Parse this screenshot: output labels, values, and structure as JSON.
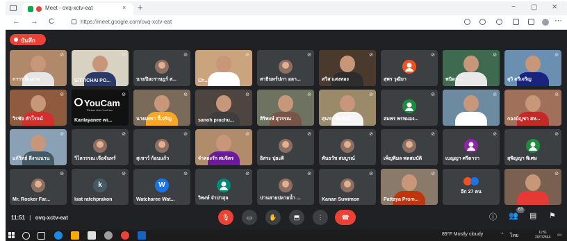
{
  "browser": {
    "tab_title": "Meet - ovq-xctv-eat",
    "tab_close": "×",
    "new_tab": "+",
    "url": "https://meet.google.com/ovq-xctv-eat",
    "win_min": "−",
    "win_max": "▢",
    "win_close": "✕",
    "back": "←",
    "forward": "→",
    "reload": "C",
    "more": "⋯"
  },
  "recording_label": "บันทึก",
  "tiles": [
    {
      "name": "กาาร ผิ้นลาจ",
      "type": "video",
      "bg": "#b0896b",
      "shirt": "#e6e6e6"
    },
    {
      "name": "SITTICHAI PO...",
      "type": "video",
      "bg": "#d8d2c2",
      "shirt": "#2b3a67"
    },
    {
      "name": "นายปิยะราษฎร์ ส...",
      "type": "photo",
      "bg": "#3c4043"
    },
    {
      "name": "Ch...",
      "type": "video",
      "bg": "#c9a47c",
      "shirt": "#ffffff"
    },
    {
      "name": "สาธินทร์ปภา อลา...",
      "type": "photo",
      "bg": "#3c4043"
    },
    {
      "name": "สวิส แสงทอง",
      "type": "video",
      "bg": "#4a3a2e",
      "shirt": "#2d2d2d"
    },
    {
      "name": "สุพร วุฒิยา",
      "type": "avatar",
      "letter": "",
      "color": "#f4511e"
    },
    {
      "name": "พนิดา ...",
      "type": "video",
      "bg": "#3e6b4f",
      "shirt": "#e8e8e8"
    },
    {
      "name": "สุวิ ตรีเจริญ",
      "type": "video",
      "bg": "#6a8fb0",
      "shirt": "#1a237e"
    },
    {
      "name": "วิรชัย คำโรจน์",
      "type": "video",
      "bg": "#8f5a3d",
      "shirt": "#d32f2f"
    },
    {
      "name": "Kanlayanee wi...",
      "type": "youcam",
      "brand": "YouCam",
      "brand_sub": "Please start YouCam"
    },
    {
      "name": "นายเทพา ลี้เจริญ",
      "type": "video",
      "bg": "#7a6a5a",
      "shirt": "#f9a825"
    },
    {
      "name": "sanoh prachu...",
      "type": "video",
      "bg": "#4e4440",
      "shirt": "#3e3e3e"
    },
    {
      "name": "สิริพงษ์ สุวรรณ",
      "type": "video",
      "bg": "#6d7360",
      "shirt": "#795548"
    },
    {
      "name": "สุนทร ชัยรัตน์",
      "type": "video",
      "bg": "#9a8a6a",
      "shirt": "#f5f5f5"
    },
    {
      "name": "สมพร พรหมอง...",
      "type": "avatar",
      "letter": "",
      "color": "#1e8e3e"
    },
    {
      "name": "",
      "type": "video",
      "bg": "#6c8aa0",
      "shirt": "#ffffff",
      "highlight": true
    },
    {
      "name": "กองบัญชา สห...",
      "type": "video",
      "bg": "#a0705a",
      "shirt": "#c62828"
    },
    {
      "name": "แก้วิทย์ ดีงามนาน",
      "type": "video",
      "bg": "#8aa0b5",
      "shirt": "#455a64"
    },
    {
      "name": "วิไลวรรณ เจือจันทร์",
      "type": "photo",
      "bg": "#3c4043"
    },
    {
      "name": "สุเชาว์ ก้อนแก้ว",
      "type": "photo",
      "bg": "#3c4043"
    },
    {
      "name": "จำลองรัก สมจิตร",
      "type": "video",
      "bg": "#b08c6a",
      "shirt": "#6a1b9a"
    },
    {
      "name": "อิสระ ปุยะติ",
      "type": "photo",
      "bg": "#3c4043"
    },
    {
      "name": "พันธวัช สมบูรณ์",
      "type": "photo",
      "bg": "#3c4043"
    },
    {
      "name": "เพ็ญพิมล พลสมบัติ",
      "type": "photo",
      "bg": "#3c4043"
    },
    {
      "name": "เบญญา ศรีดารา",
      "type": "avatar",
      "letter": "",
      "color": "#8e24aa"
    },
    {
      "name": "สุพิญญา พิเศษ",
      "type": "avatar",
      "letter": "",
      "color": "#1e8e3e"
    },
    {
      "name": "Mr. Rocker Far...",
      "type": "photo",
      "bg": "#3c4043"
    },
    {
      "name": "kiat ratchprakon",
      "type": "avatar",
      "letter": "k",
      "color": "#455a64"
    },
    {
      "name": "Watcharee Wat...",
      "type": "avatar",
      "letter": "W",
      "color": "#1a73e8"
    },
    {
      "name": "วิพงษ์ จำปาสุล",
      "type": "avatar",
      "letter": "",
      "color": "#00897b"
    },
    {
      "name": "ปานสายปลายน้ำ ...",
      "type": "photo",
      "bg": "#3c4043"
    },
    {
      "name": "Kanan Suwimon",
      "type": "photo",
      "bg": "#3c4043"
    },
    {
      "name": "Pattaya Prom...",
      "type": "video",
      "bg": "#8a7a6a",
      "shirt": "#bf360c"
    },
    {
      "name": "อีก 27 คน",
      "type": "group"
    },
    {
      "name": "",
      "type": "video",
      "bg": "#7a6050",
      "shirt": "#e53935"
    }
  ],
  "meeting": {
    "time": "11:51",
    "separator": "|",
    "code": "ovq-xctv-eat",
    "participant_count": "63"
  },
  "controls": {
    "mic": "🎙",
    "camera": "▭",
    "raise_hand": "✋",
    "present": "⬒",
    "more": "⋮",
    "end_call": "☎",
    "info": "ⓘ",
    "people": "👥",
    "chat": "▤",
    "activities": "⚑"
  },
  "taskbar": {
    "weather": "89°F  Mostly cloudy",
    "lang": "ไทย",
    "time": "11:51",
    "date": "20/7/2564"
  },
  "colors": {
    "meet_bg": "#202124",
    "tile_bg": "#3c4043",
    "accent_red": "#ea4335",
    "highlight_border": "#8ab4f8"
  }
}
